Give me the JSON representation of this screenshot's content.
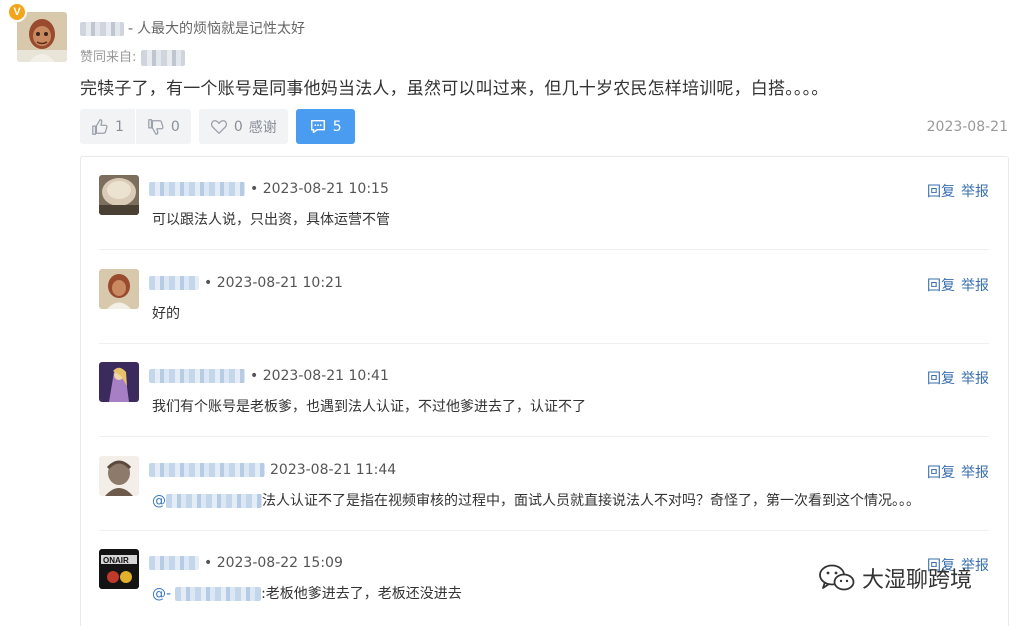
{
  "post": {
    "author_badge": "V",
    "author_separator": "-",
    "author_tagline": "人最大的烦恼就是记性太好",
    "via_label": "赞同来自:",
    "content": "完犊子了，有一个账号是同事他妈当法人，虽然可以叫过来，但几十岁农民怎样培训呢，白搭。。。。",
    "likes": "1",
    "dislikes": "0",
    "thanks_count": "0",
    "thanks_label": "感谢",
    "comments": "5",
    "date": "2023-08-21"
  },
  "replies": [
    {
      "timestamp": "• 2023-08-21 10:15",
      "text": "可以跟法人说，只出资，具体运营不管",
      "mention": "",
      "reply_label": "回复",
      "report_label": "举报"
    },
    {
      "timestamp": "• 2023-08-21 10:21",
      "text": "好的",
      "mention": "",
      "reply_label": "回复",
      "report_label": "举报"
    },
    {
      "timestamp": "• 2023-08-21 10:41",
      "text": "我们有个账号是老板爹，也遇到法人认证，不过他爹进去了，认证不了",
      "mention": "",
      "reply_label": "回复",
      "report_label": "举报"
    },
    {
      "timestamp": "2023-08-21 11:44",
      "text": "法人认证不了是指在视频审核的过程中，面试人员就直接说法人不对吗？奇怪了，第一次看到这个情况。。。",
      "mention": "@",
      "reply_label": "回复",
      "report_label": "举报"
    },
    {
      "timestamp": "• 2023-08-22 15:09",
      "text": ":老板他爹进去了，老板还没进去",
      "mention": "@-",
      "reply_label": "回复",
      "report_label": "举报"
    }
  ],
  "watermark": {
    "text": "大湿聊跨境",
    "icon": "wechat-icon"
  },
  "colors": {
    "primary": "#4a9cf0",
    "link": "#3a6fae",
    "mention": "#3a77c9",
    "badge": "#f4a418"
  }
}
